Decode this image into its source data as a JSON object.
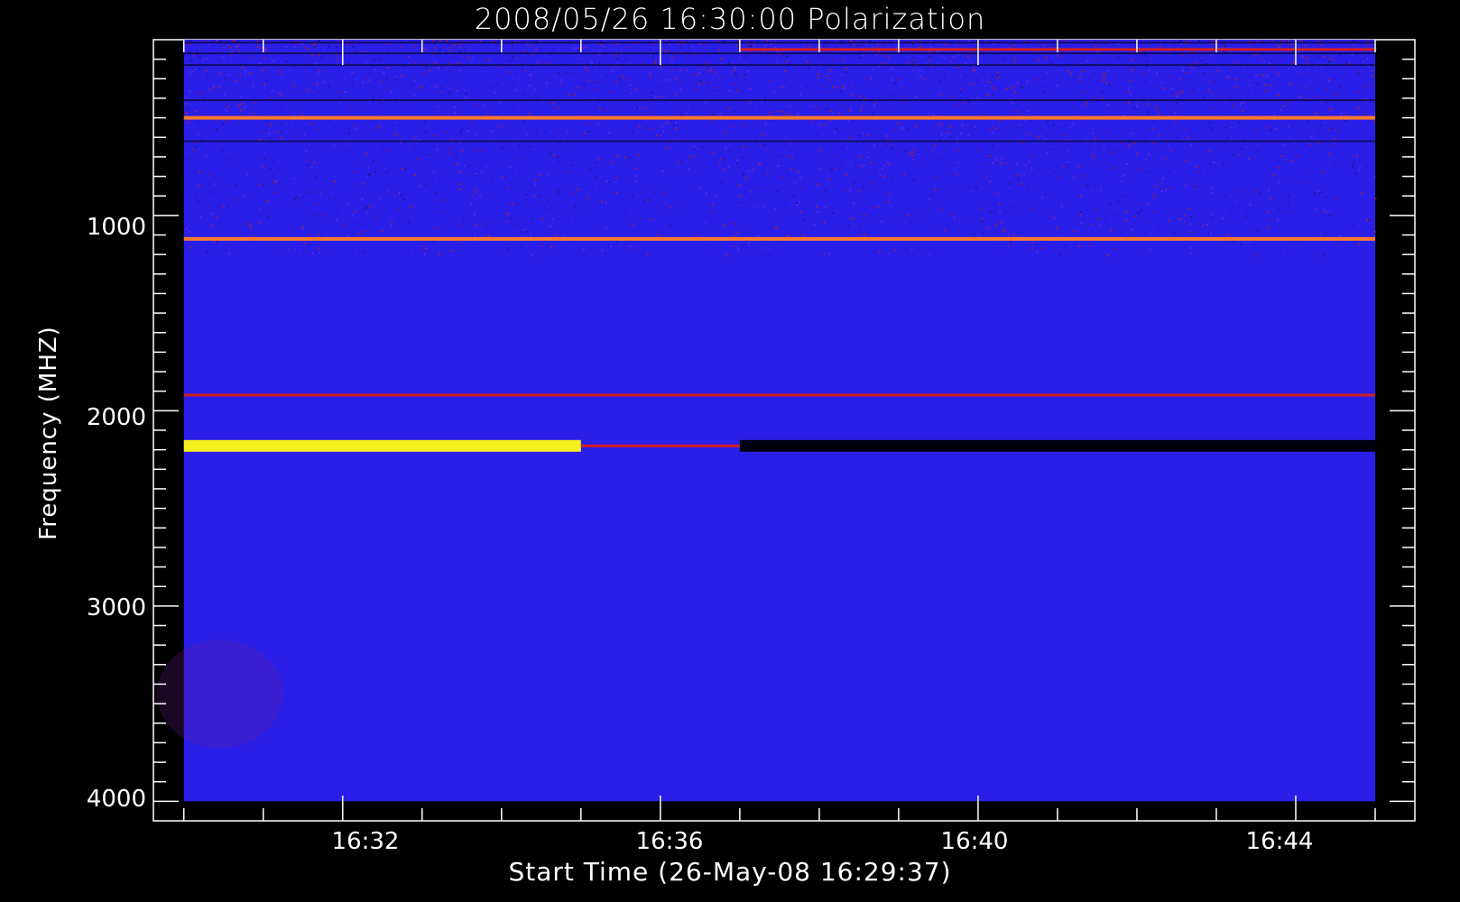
{
  "chart_data": {
    "type": "heatmap",
    "title": "2008/05/26 16:30:00 Polarization",
    "xlabel": "Start Time (26-May-08 16:29:37)",
    "ylabel": "Frequency (MHZ)",
    "x_ticks": [
      "16:32",
      "16:36",
      "16:40",
      "16:44"
    ],
    "y_ticks": [
      "1000",
      "2000",
      "3000",
      "4000"
    ],
    "xlim": [
      "16:29:37",
      "16:45:30"
    ],
    "ylim": [
      4100,
      100
    ],
    "data_x_range": [
      "16:30:00",
      "16:45:00"
    ],
    "data_y_range_mhz": [
      100,
      4000
    ],
    "y_inverted": true,
    "background_color": "#000000",
    "colors": {
      "base": "#2a1fe8",
      "dark": "#000010",
      "red": "#d42020",
      "orange": "#ff7a2a",
      "yellow": "#f5f020"
    },
    "features": [
      {
        "freq_mhz": 150,
        "t_start": "16:37:00",
        "t_end": "16:45:00",
        "color": "red"
      },
      {
        "freq_mhz": 500,
        "t_start": "16:30:00",
        "t_end": "16:45:00",
        "color": "orange"
      },
      {
        "freq_mhz": 1120,
        "t_start": "16:30:00",
        "t_end": "16:45:00",
        "color": "orange"
      },
      {
        "freq_mhz": 1920,
        "t_start": "16:30:00",
        "t_end": "16:45:00",
        "color": "red"
      },
      {
        "freq_mhz": 2180,
        "t_start": "16:30:00",
        "t_end": "16:35:00",
        "color": "yellow"
      },
      {
        "freq_mhz": 2180,
        "t_start": "16:35:00",
        "t_end": "16:37:00",
        "color": "red"
      },
      {
        "freq_mhz": 2180,
        "t_start": "16:37:00",
        "t_end": "16:45:00",
        "color": "dark"
      }
    ]
  }
}
